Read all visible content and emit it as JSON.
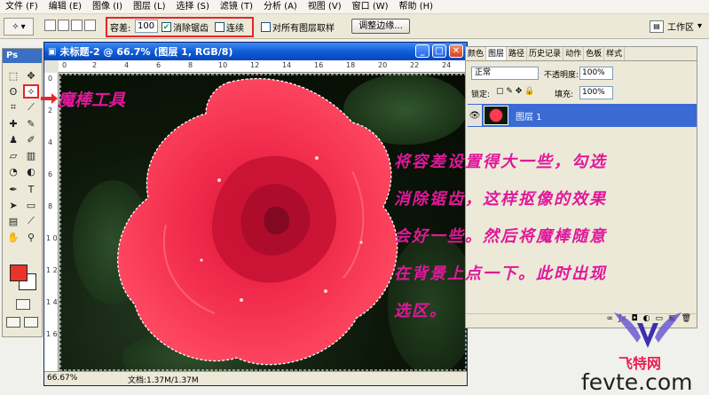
{
  "menubar": {
    "items": [
      "文件 (F)",
      "编辑 (E)",
      "图像 (I)",
      "图层 (L)",
      "选择 (S)",
      "滤镜 (T)",
      "分析 (A)",
      "视图 (V)",
      "窗口 (W)",
      "帮助 (H)"
    ]
  },
  "options": {
    "tolerance_label": "容差:",
    "tolerance_value": "100",
    "antialias_label": "消除锯齿",
    "contiguous_label": "连续",
    "sample_all_label": "对所有图层取样",
    "refine_edge_label": "调整边缘...",
    "workspace_label": "工作区"
  },
  "toolbox": {
    "logo": "Ps"
  },
  "document": {
    "title": "未标题-2 @ 66.7% (图层 1, RGB/8)",
    "zoom": "66.67%",
    "doc_info": "文档:1.37M/1.37M",
    "ruler_top": [
      "0",
      "2",
      "4",
      "6",
      "8",
      "10",
      "12",
      "14",
      "16",
      "18",
      "20",
      "22",
      "24"
    ],
    "ruler_left": [
      "0",
      "2",
      "4",
      "6",
      "8",
      "1 0",
      "1 2",
      "1 4",
      "1 6"
    ]
  },
  "layers_panel": {
    "tabs": [
      "颜色",
      "图层",
      "路径",
      "历史记录",
      "动作",
      "色板",
      "样式"
    ],
    "blend_mode": "正常",
    "opacity_label": "不透明度:",
    "opacity_value": "100%",
    "lock_label": "锁定:",
    "fill_label": "填充:",
    "fill_value": "100%",
    "layer_name": "图层 1"
  },
  "annotations": {
    "callout": "魔棒工具",
    "note_lines": [
      "将容差设置得大一些，勾选",
      "消除锯齿，这样抠像的效果",
      "会好一些。然后将魔棒随意",
      "在背景上点一下。此时出现",
      "选区。"
    ]
  },
  "watermark": {
    "cn": "飞特网",
    "url": "fevte.com"
  },
  "colors": {
    "annotation": "#e0189a",
    "highlight": "#e8242a",
    "foreground": "#e8352b",
    "background": "#ffffff"
  }
}
